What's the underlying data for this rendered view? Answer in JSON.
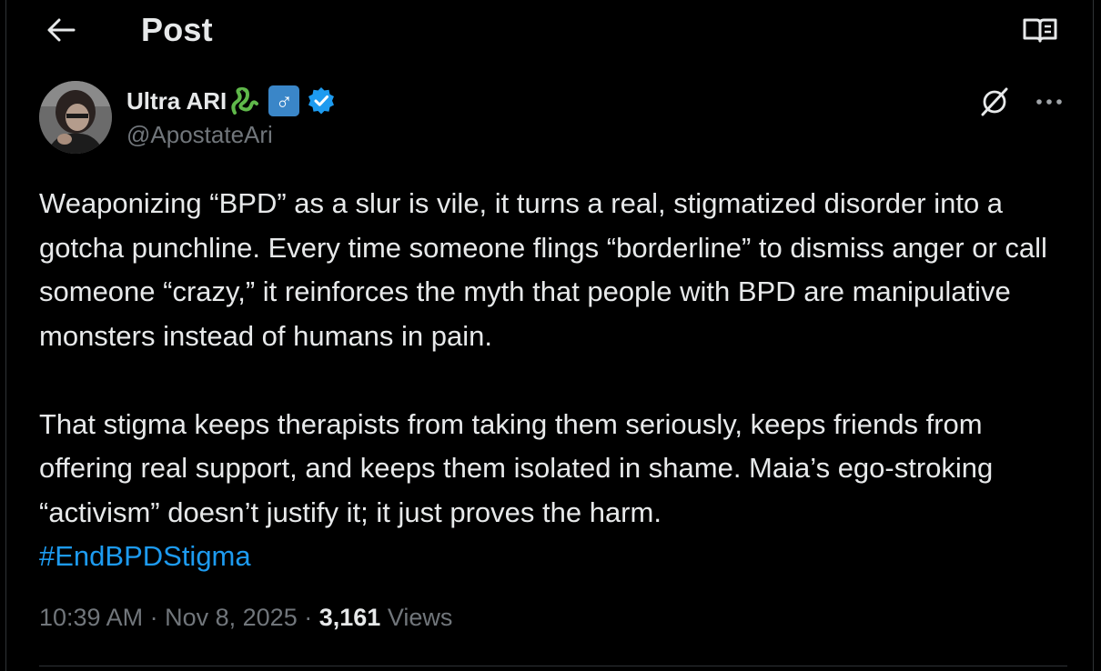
{
  "header": {
    "title": "Post",
    "back_icon": "arrow-left-icon",
    "reader_icon": "book-open-icon"
  },
  "author": {
    "display_name": "Ultra ARI",
    "emoji_snake": "🐍",
    "emoji_male_sign": "♂",
    "handle": "@ApostateAri",
    "verified": true,
    "verified_color": "#1d9bf0"
  },
  "post": {
    "paragraph1": "Weaponizing “BPD” as a slur is vile, it turns a real, stigmatized disorder into a gotcha punchline. Every time someone flings “borderline” to dismiss anger or call someone “crazy,” it reinforces the myth that people with BPD are manipulative monsters instead of humans in pain.",
    "paragraph2": "That stigma keeps therapists from taking them seriously, keeps friends from offering real support, and keeps them isolated in shame. Maia’s ego-stroking “activism” doesn’t justify it; it just proves the harm.",
    "hashtag": "#EndBPDStigma",
    "hashtag_color": "#1d9bf0"
  },
  "meta": {
    "time": "10:39 AM",
    "date": "Nov 8, 2025",
    "separator": "·",
    "views_count": "3,161",
    "views_label": "Views"
  },
  "colors": {
    "background": "#000000",
    "text": "#e7e9ea",
    "muted": "#71767b",
    "accent": "#1d9bf0"
  }
}
